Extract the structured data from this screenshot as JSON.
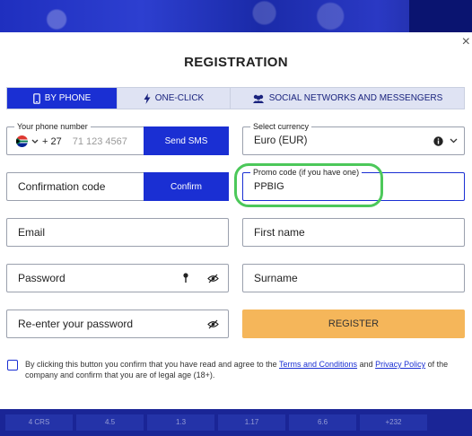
{
  "background": {
    "bottom_row": [
      "4 CRS",
      "4.5",
      "1.3",
      "1.17",
      "6.6",
      "+232"
    ]
  },
  "modal": {
    "title": "REGISTRATION",
    "close_symbol": "×"
  },
  "tabs": [
    {
      "label": "BY PHONE",
      "icon": "phone-icon",
      "active": true
    },
    {
      "label": "ONE-CLICK",
      "icon": "lightning-icon",
      "active": false
    },
    {
      "label": "SOCIAL NETWORKS AND MESSENGERS",
      "icon": "users-icon",
      "active": false
    }
  ],
  "phone": {
    "label": "Your phone number",
    "country_code": "+ 27",
    "placeholder": "71 123 4567",
    "send_sms": "Send SMS",
    "flag_icon": "south-africa-flag-icon"
  },
  "currency": {
    "label": "Select currency",
    "value": "Euro (EUR)"
  },
  "confirmation": {
    "placeholder": "Confirmation code",
    "button": "Confirm"
  },
  "promo": {
    "label": "Promo code (if you have one)",
    "value": "PPBIG"
  },
  "email": {
    "placeholder": "Email"
  },
  "first_name": {
    "placeholder": "First name"
  },
  "password": {
    "placeholder": "Password"
  },
  "surname": {
    "placeholder": "Surname"
  },
  "repassword": {
    "placeholder": "Re-enter your password"
  },
  "register_button": "REGISTER",
  "terms": {
    "before": "By clicking this button you confirm that you have read and agree to the ",
    "terms_link": "Terms and Conditions",
    "and": " and ",
    "privacy_link": "Privacy Policy",
    "after": " of the company and confirm that you are of legal age (18+)."
  },
  "colors": {
    "accent": "#1a2fd3",
    "register": "#f5b65a",
    "highlight": "#4cc85a"
  }
}
